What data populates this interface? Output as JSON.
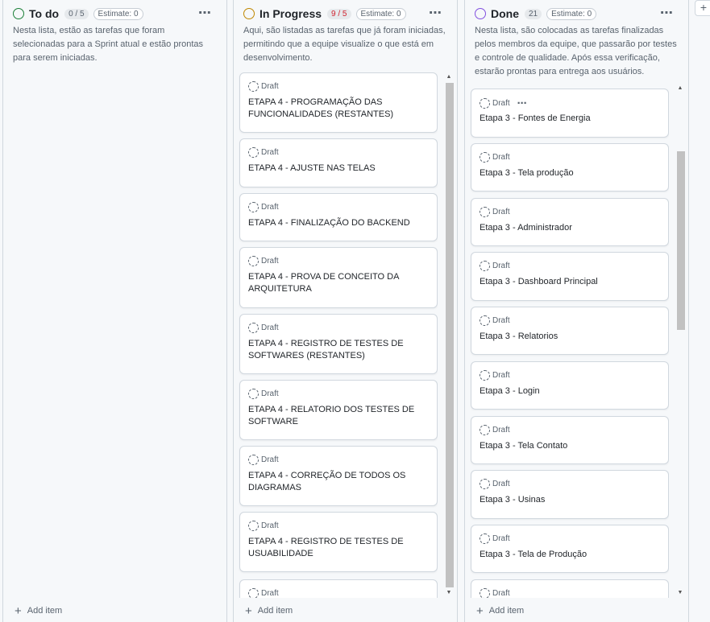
{
  "columns": {
    "todo": {
      "title": "To do",
      "count": "0 / 5",
      "estimate": "Estimate: 0",
      "menu": "⋯",
      "description": "Nesta lista, estão as tarefas que foram selecionadas para a Sprint atual e estão prontas para serem iniciadas.",
      "add_label": "Add item",
      "status_color": "#1a7f37"
    },
    "progress": {
      "title": "In Progress",
      "count": "9 / 5",
      "estimate": "Estimate: 0",
      "menu": "⋯",
      "description": "Aqui, são listadas as tarefas que já foram iniciadas, permitindo que a equipe visualize o que está em desenvolvimento.",
      "add_label": "Add item",
      "status_color": "#bf8700",
      "cards": [
        {
          "draft": "Draft",
          "title": "ETAPA 4 - PROGRAMAÇÃO DAS FUNCIONALIDADES (RESTANTES)"
        },
        {
          "draft": "Draft",
          "title": "ETAPA 4 - AJUSTE NAS TELAS"
        },
        {
          "draft": "Draft",
          "title": "ETAPA 4 - FINALIZAÇÃO DO BACKEND"
        },
        {
          "draft": "Draft",
          "title": "ETAPA 4 - PROVA DE CONCEITO DA ARQUITETURA"
        },
        {
          "draft": "Draft",
          "title": "ETAPA 4 - REGISTRO DE TESTES DE SOFTWARES (RESTANTES)"
        },
        {
          "draft": "Draft",
          "title": "ETAPA 4 - RELATORIO DOS TESTES DE SOFTWARE"
        },
        {
          "draft": "Draft",
          "title": "ETAPA 4 - CORREÇÃO DE TODOS OS DIAGRAMAS"
        },
        {
          "draft": "Draft",
          "title": "ETAPA 4 - REGISTRO DE TESTES DE USUABILIDADE"
        },
        {
          "draft": "Draft",
          "title": ""
        }
      ]
    },
    "done": {
      "title": "Done",
      "count": "21",
      "estimate": "Estimate: 0",
      "menu": "⋯",
      "description": "Nesta lista, são colocadas as tarefas finalizadas pelos membros da equipe, que passarão por testes e controle de qualidade. Após essa verificação, estarão prontas para entrega aos usuários.",
      "add_label": "Add item",
      "status_color": "#8250df",
      "card_menu": "⋯",
      "cards": [
        {
          "draft": "Draft",
          "title": "Etapa 3 - Fontes de Energia"
        },
        {
          "draft": "Draft",
          "title": "Etapa 3 - Tela produção"
        },
        {
          "draft": "Draft",
          "title": "Etapa 3 - Administrador"
        },
        {
          "draft": "Draft",
          "title": "Etapa 3 - Dashboard Principal"
        },
        {
          "draft": "Draft",
          "title": "Etapa 3 - Relatorios"
        },
        {
          "draft": "Draft",
          "title": "Etapa 3 - Login"
        },
        {
          "draft": "Draft",
          "title": "Etapa 3 - Tela Contato"
        },
        {
          "draft": "Draft",
          "title": "Etapa 3 - Usinas"
        },
        {
          "draft": "Draft",
          "title": "Etapa 3 - Tela de Produção"
        },
        {
          "draft": "Draft",
          "title": ""
        }
      ]
    }
  },
  "add_column_label": "+",
  "add_plus": "+"
}
